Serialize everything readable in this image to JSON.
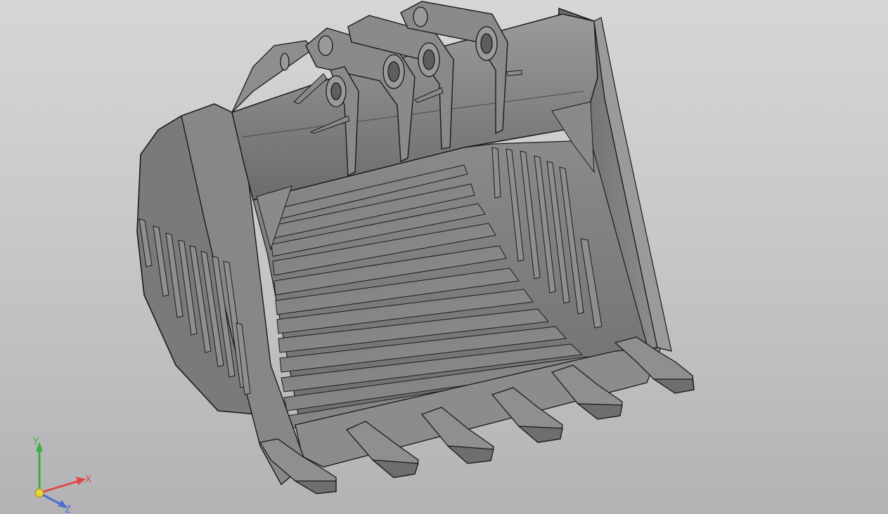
{
  "viewport": {
    "background_top": "#d6d6d6",
    "background_bottom": "#b3b3b6"
  },
  "model": {
    "description_icon": "excavator-bucket-3d-model",
    "shade_dark": "#5e5e5e",
    "shade_mid": "#7a7a7a",
    "shade_light": "#9a9a9a",
    "edge_color": "#1a1a1a"
  },
  "triad": {
    "x_label": "X",
    "y_label": "Y",
    "z_label": "Z",
    "x_color": "#e04848",
    "y_color": "#3fae3f",
    "z_color": "#4f6fd0",
    "origin_color": "#e8d23a"
  }
}
